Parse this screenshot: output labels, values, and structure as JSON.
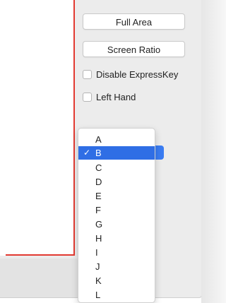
{
  "buttons": {
    "full_area": "Full Area",
    "screen_ratio": "Screen Ratio"
  },
  "checkboxes": [
    {
      "label": "Disable ExpressKey",
      "checked": false
    },
    {
      "label": "Left Hand",
      "checked": false
    }
  ],
  "dropdown": {
    "selected": "B",
    "check_glyph": "✓",
    "items": [
      "A",
      "B",
      "C",
      "D",
      "E",
      "F",
      "G",
      "H",
      "I",
      "J",
      "K",
      "L"
    ]
  },
  "colors": {
    "accent": "#2f6ee5",
    "area_outline": "#e23a31"
  }
}
